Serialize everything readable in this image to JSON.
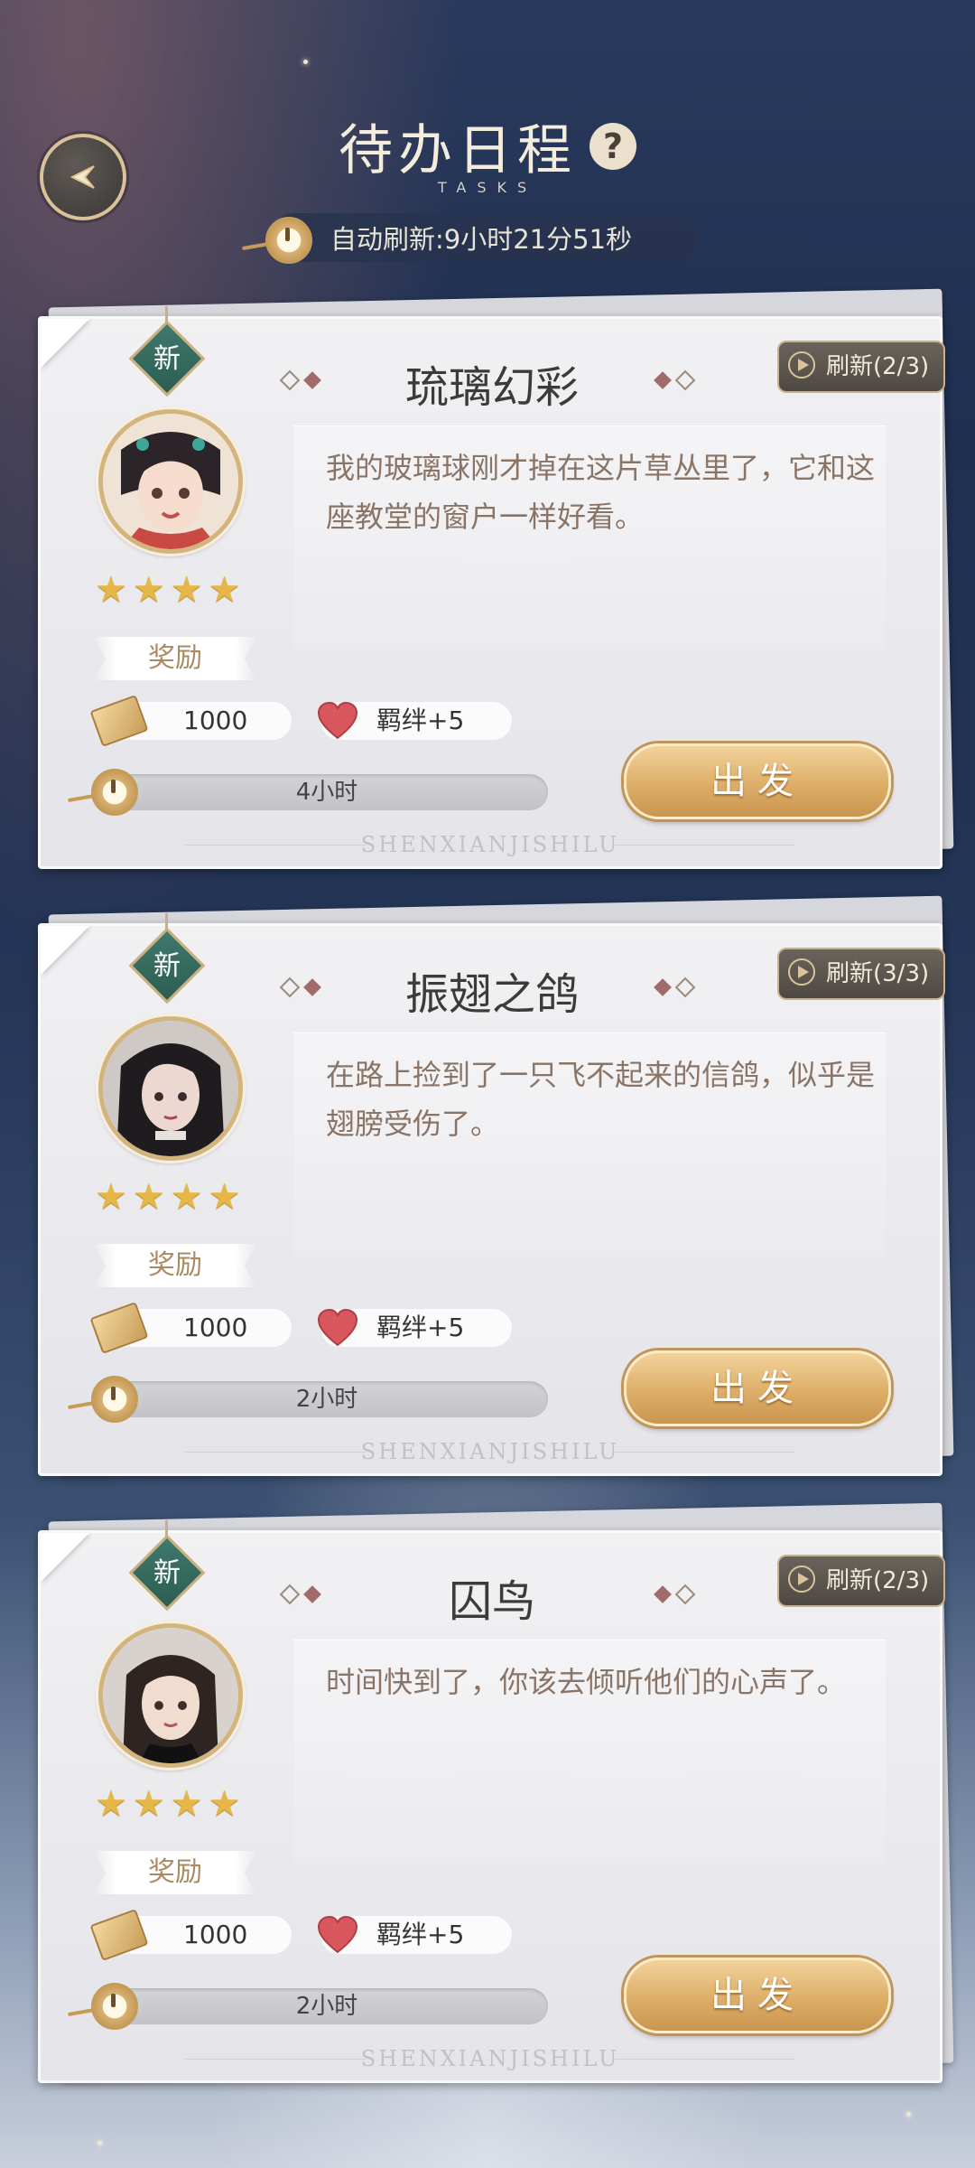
{
  "header": {
    "title": "待办日程",
    "subtitle": "TASKS",
    "help_icon": "?",
    "auto_refresh": "自动刷新:9小时21分51秒"
  },
  "tasks": [
    {
      "new_tag": "新",
      "title": "琉璃幻彩",
      "refresh": "刷新(2/3)",
      "description": "我的玻璃球刚才掉在这片草丛里了，它和这座教堂的窗户一样好看。",
      "stars": 4,
      "reward_label": "奖励",
      "coupon_amount": "1000",
      "bond_reward": "羁绊+5",
      "duration": "4小时",
      "go_label": "出发",
      "watermark": "SHENXIANJISHILU"
    },
    {
      "new_tag": "新",
      "title": "振翅之鸽",
      "refresh": "刷新(3/3)",
      "description": "在路上捡到了一只飞不起来的信鸽，似乎是翅膀受伤了。",
      "stars": 4,
      "reward_label": "奖励",
      "coupon_amount": "1000",
      "bond_reward": "羁绊+5",
      "duration": "2小时",
      "go_label": "出发",
      "watermark": "SHENXIANJISHILU"
    },
    {
      "new_tag": "新",
      "title": "囚鸟",
      "refresh": "刷新(2/3)",
      "description": "时间快到了，你该去倾听他们的心声了。",
      "stars": 4,
      "reward_label": "奖励",
      "coupon_amount": "1000",
      "bond_reward": "羁绊+5",
      "duration": "2小时",
      "go_label": "出发",
      "watermark": "SHENXIANJISHILU"
    }
  ],
  "icons": {
    "back": "back-arrow-icon",
    "timer": "pocket-watch-icon",
    "coupon": "coupon-ticket-icon",
    "bond": "heart-icon",
    "refresh": "play-icon",
    "star": "star-icon"
  },
  "colors": {
    "gold_button": "#deae68",
    "star": "#e6b746",
    "new_tag": "#3f7a6c",
    "heart": "#d9575f"
  }
}
